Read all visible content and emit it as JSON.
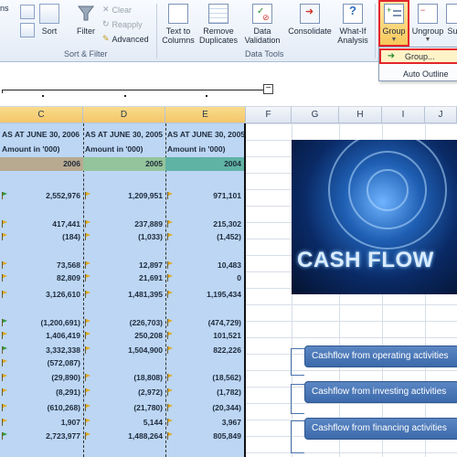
{
  "ribbon": {
    "partial_tab": "ns",
    "sort": {
      "az_label": "A↓Z",
      "sort_label": "Sort"
    },
    "filter": {
      "label": "Filter",
      "clear": "Clear",
      "reapply": "Reapply",
      "advanced": "Advanced"
    },
    "group_sort_filter": "Sort & Filter",
    "text_to_columns": [
      "Text to",
      "Columns"
    ],
    "remove_duplicates": [
      "Remove",
      "Duplicates"
    ],
    "data_validation": [
      "Data",
      "Validation"
    ],
    "consolidate": "Consolidate",
    "what_if": [
      "What-If",
      "Analysis"
    ],
    "group_data_tools": "Data Tools",
    "group_btn": "Group",
    "ungroup_btn": "Ungroup",
    "subtotal_partial": "Su"
  },
  "dropdown": {
    "group_item": "Group...",
    "auto_outline": "Auto Outline"
  },
  "columns": [
    "C",
    "D",
    "E",
    "F",
    "G",
    "H",
    "I",
    "J"
  ],
  "table": {
    "headers": [
      "AS AT JUNE 30, 2006",
      "AS AT JUNE 30, 2005",
      "AS AT JUNE 30, 2005"
    ],
    "amount_label": "Amount in '000)",
    "years": [
      "2006",
      "2005",
      "2004"
    ],
    "rows": [
      [
        "2,552,976",
        "1,209,951",
        "971,101"
      ],
      [
        "417,441",
        "237,889",
        "215,302"
      ],
      [
        "(184)",
        "(1,033)",
        "(1,452)"
      ],
      [
        "73,568",
        "12,897",
        "10,483"
      ],
      [
        "82,809",
        "21,691",
        "0"
      ],
      [
        "3,126,610",
        "1,481,395",
        "1,195,434"
      ],
      [
        "(1,200,691)",
        "(226,703)",
        "(474,729)"
      ],
      [
        "1,406,419",
        "250,208",
        "101,521"
      ],
      [
        "3,332,338",
        "1,504,900",
        "822,226"
      ],
      [
        "(572,087)",
        "",
        ""
      ],
      [
        "(29,890)",
        "(18,808)",
        "(18,562)"
      ],
      [
        "(8,291)",
        "(2,972)",
        "(1,782)"
      ],
      [
        "(610,268)",
        "(21,780)",
        "(20,344)"
      ],
      [
        "1,907",
        "5,144",
        "3,967"
      ],
      [
        "2,723,977",
        "1,488,264",
        "805,849"
      ]
    ]
  },
  "image_caption": "CASH FLOW",
  "flow": [
    "Cashflow from operating activities",
    "Cashflow from investing activities",
    "Cashflow from financing activities"
  ],
  "colors": {
    "selection": "#bcd6f4",
    "highlight_border": "#e3262a",
    "flowbox": "#4a78b8"
  }
}
